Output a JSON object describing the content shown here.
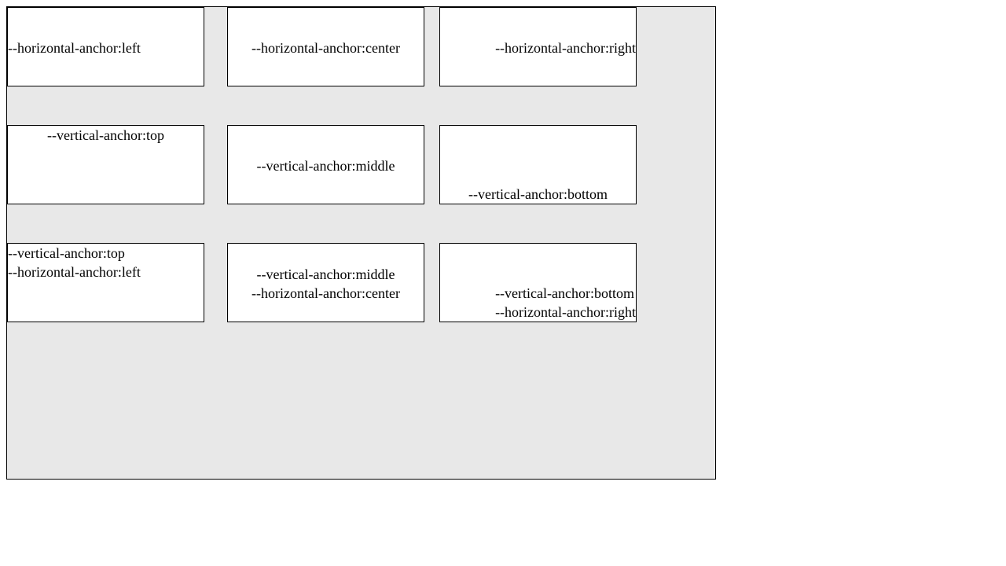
{
  "boxes": {
    "h_left": {
      "lines": [
        "--horizontal-anchor:left"
      ]
    },
    "h_center": {
      "lines": [
        "--horizontal-anchor:center"
      ]
    },
    "h_right": {
      "lines": [
        "--horizontal-anchor:right"
      ]
    },
    "v_top": {
      "lines": [
        "--vertical-anchor:top"
      ]
    },
    "v_middle": {
      "lines": [
        "--vertical-anchor:middle"
      ]
    },
    "v_bottom": {
      "lines": [
        "--vertical-anchor:bottom"
      ]
    },
    "top_left": {
      "lines": [
        "--vertical-anchor:top",
        "--horizontal-anchor:left"
      ]
    },
    "middle_center": {
      "lines": [
        "--vertical-anchor:middle",
        "--horizontal-anchor:center"
      ]
    },
    "bottom_right": {
      "lines": [
        "--vertical-anchor:bottom",
        "--horizontal-anchor:right"
      ]
    }
  },
  "colors": {
    "canvas_bg": "#e8e8e8",
    "box_bg": "#ffffff",
    "border": "#000000"
  }
}
